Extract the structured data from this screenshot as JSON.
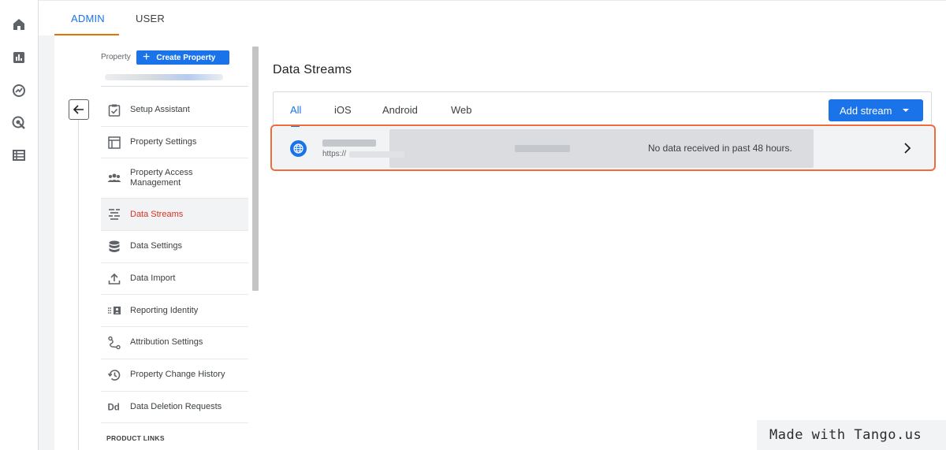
{
  "rail": {
    "icons": [
      "home-icon",
      "reports-icon",
      "explore-icon",
      "advertising-icon",
      "configure-icon"
    ]
  },
  "tabs": {
    "admin": "ADMIN",
    "user": "USER"
  },
  "property": {
    "label": "Property",
    "create_button": "Create Property"
  },
  "nav": {
    "items": [
      {
        "label": "Setup Assistant",
        "icon": "checklist-icon"
      },
      {
        "label": "Property Settings",
        "icon": "layout-icon"
      },
      {
        "label": "Property Access Management",
        "icon": "people-icon"
      },
      {
        "label": "Data Streams",
        "icon": "streams-icon",
        "active": true
      },
      {
        "label": "Data Settings",
        "icon": "database-icon"
      },
      {
        "label": "Data Import",
        "icon": "upload-icon"
      },
      {
        "label": "Reporting Identity",
        "icon": "identity-icon"
      },
      {
        "label": "Attribution Settings",
        "icon": "attribution-icon"
      },
      {
        "label": "Property Change History",
        "icon": "history-icon"
      },
      {
        "label": "Data Deletion Requests",
        "icon": "dd-icon"
      }
    ],
    "product_links": "PRODUCT LINKS"
  },
  "main": {
    "title": "Data Streams",
    "stream_tabs": [
      "All",
      "iOS",
      "Android",
      "Web"
    ],
    "add_stream": "Add stream",
    "stream": {
      "url_prefix": "https://",
      "status": "No data received in past 48 hours."
    }
  },
  "watermark": "Made with Tango.us",
  "colors": {
    "accent": "#1a73e8",
    "active_nav": "#d93025",
    "highlight": "#f26a3b",
    "tab_underline": "#e37400"
  }
}
